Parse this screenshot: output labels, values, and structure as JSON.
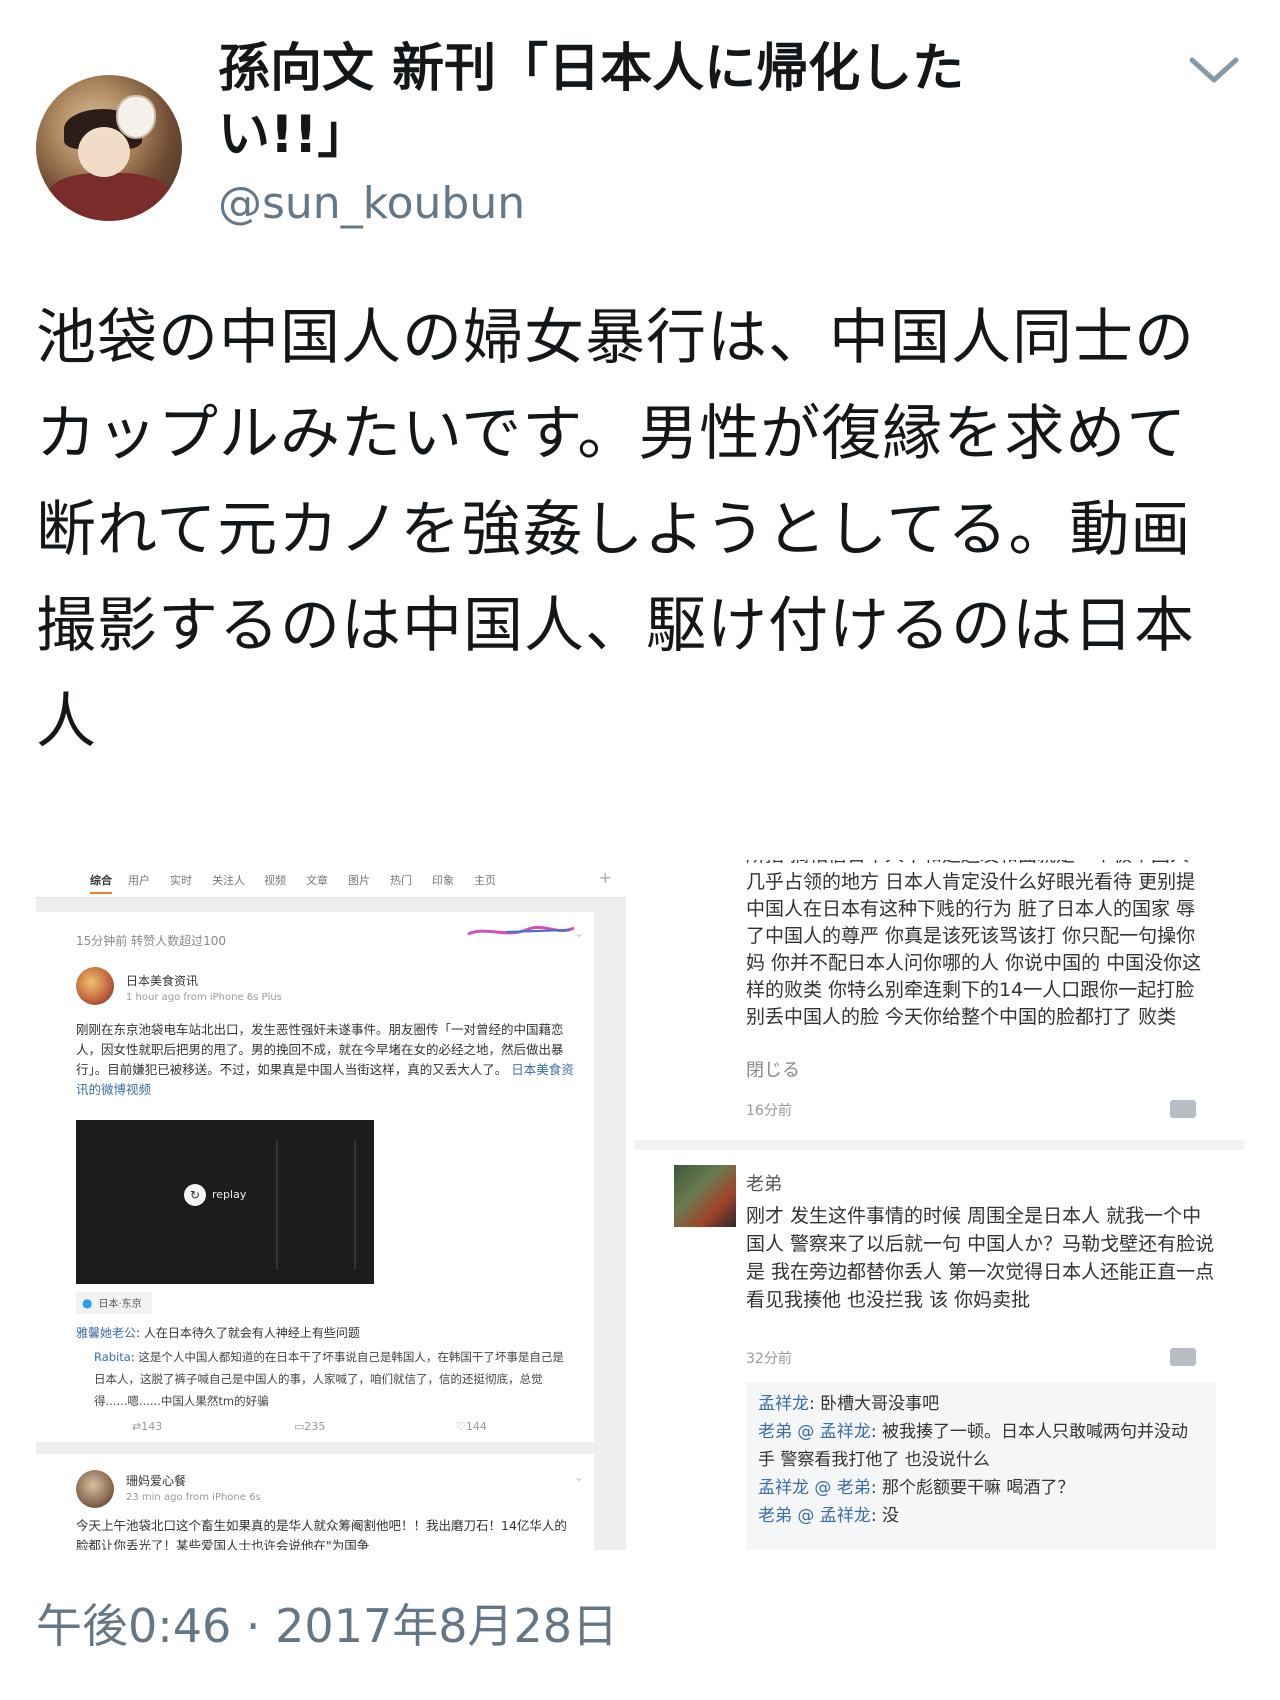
{
  "tweet": {
    "display_name": "孫向文 新刊「日本人に帰化したい!!」",
    "handle": "@sun_koubun",
    "menu_icon": "chevron-down-icon",
    "text": "池袋の中国人の婦女暴行は、中国人同士のカップルみたいです。男性が復縁を求めて断れて元カノを強姦しようとしてる。動画撮影するのは中国人、駆け付けるのは日本人",
    "timestamp": "午後0:46 · 2017年8月28日"
  },
  "weibo_screenshot": {
    "tabs": [
      "综合",
      "用户",
      "实时",
      "关注人",
      "视频",
      "文章",
      "图片",
      "热门",
      "印象",
      "主页"
    ],
    "tab_plus": "+",
    "hot_line": "15分钟前 转赞人数超过100",
    "post1": {
      "user": "日本美食资讯",
      "meta": "1 hour ago  from iPhone 6s Plus",
      "text": "刚刚在东京池袋电车站北出口，发生恶性强奸未遂事件。朋友圈传「一对曾经的中国藉恋人，因女性就职后把男的甩了。男的挽回不成，就在今早堵在女的必经之地，然后做出暴行」。目前嫌犯已被移送。不过，如果真是中国人当街这样，真的又丢大人了。",
      "video_link": "日本美食资讯的微博视频",
      "replay": "replay",
      "location": "日本·东京",
      "comment1_user": "雅馨她老公",
      "comment1_text": ": 人在日本待久了就会有人神经上有些问题",
      "comment2_user": "Rabita",
      "comment2_text": ": 这是个人中国人都知道的在日本干了坏事说自己是韩国人，在韩国干了坏事是自己是日本人，这脱了裤子喊自己是中国人的事，人家喊了，咱们就信了，信的还挺彻底，总觉得......嗯......中国人果然tm的好骗",
      "reposts": "143",
      "comments": "235",
      "likes": "144"
    },
    "post2": {
      "user": "珊妈爱心餐",
      "meta": "23 min ago  from iPhone 6s",
      "text": "今天上午池袋北口这个畜生如果真的是华人就众筹阉割他吧！！我出磨刀石！14亿华人的脸都让你丢光了！某些爱国人士也许会说他在\"为国争"
    }
  },
  "comments_screenshot": {
    "block1": "所指 搞相信日本人不和廷还发和曲就是一个极个国人几乎占领的地方 日本人肯定没什么好眼光看待 更别提中国人在日本有这种下贱的行为 脏了日本人的国家 辱了中国人的尊严 你真是该死该骂该打 你只配一句操你妈 你并不配日本人问你哪的人 你说中国的 中国没你这样的败类 你特么别牵连剩下的14一人口跟你一起打脸 别丢中国人的脸 今天你给整个中国的脸都打了 败类",
    "close": "閉じる",
    "time1": "16分前",
    "name": "老弟",
    "body": "刚才 发生这件事情的时候 周围全是日本人 就我一个中国人 警察来了以后就一句 中国人か？马勒戈壁还有脸说 是 我在旁边都替你丢人 第一次觉得日本人还能正直一点 看见我揍他 也没拦我 该 你妈卖批",
    "time2": "32分前",
    "reply1_user": "孟祥龙",
    "reply1_text": ": 卧槽大哥没事吧",
    "reply2_user": "老弟 @ 孟祥龙",
    "reply2_text": ": 被我揍了一顿。日本人只敢喊两句并没动手 警察看我打他了 也没说什么",
    "reply3_user": "孟祥龙 @ 老弟",
    "reply3_text": ": 那个彪额要干嘛 喝酒了？",
    "reply4_user": "老弟 @ 孟祥龙",
    "reply4_text": ": 没"
  }
}
